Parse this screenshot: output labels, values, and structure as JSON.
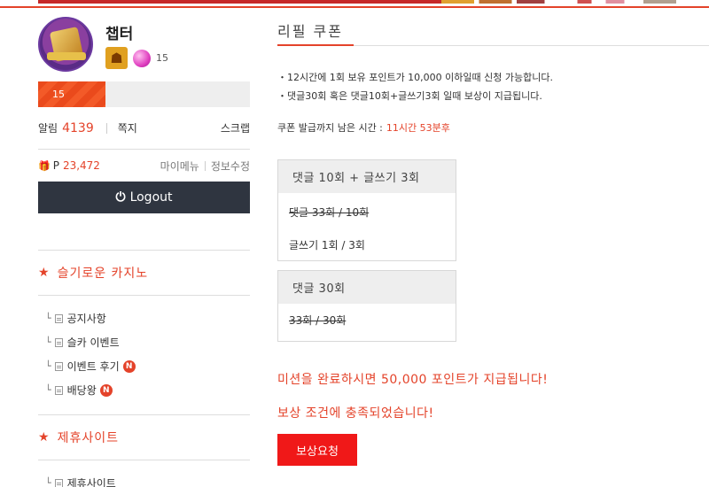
{
  "sidebar": {
    "nickname": "챕터",
    "level": "15",
    "xp_level": "15",
    "xp_progress": 0.32,
    "alarm_label": "알림",
    "alarm_count": "4139",
    "memo_label": "쪽지",
    "scrap_label": "스크랩",
    "point_prefix": "P",
    "point_value": "23,472",
    "mymenu_label": "마이메뉴",
    "edit_info_label": "정보수정",
    "logout_label": "Logout",
    "section1_title": "슬기로운 카지노",
    "section1_items": [
      {
        "label": "공지사항",
        "new": false
      },
      {
        "label": "슬카 이벤트",
        "new": false
      },
      {
        "label": "이벤트 후기",
        "new": true
      },
      {
        "label": "배당왕",
        "new": true
      }
    ],
    "new_badge": "N",
    "section2_title": "제휴사이트",
    "section2_items": [
      {
        "label": "제휴사이트"
      }
    ]
  },
  "main": {
    "page_title": "리필 쿠폰",
    "rules": [
      "・12시간에 1회 보유 포인트가 10,000 이하일때 신청 가능합니다.",
      "・댓글30회 혹은 댓글10회+글쓰기3회 일때 보상이 지급됩니다."
    ],
    "timer_label": "쿠폰 발급까지 남은 시간 :",
    "timer_value": "11시간 53분후",
    "mission1": {
      "title": "댓글 10회 + 글쓰기 3회",
      "row1": "댓글 33회 / 10회",
      "row2": "글쓰기 1회 / 3회"
    },
    "mission2": {
      "title": "댓글 30회",
      "row1": "33회 / 30회"
    },
    "complete_msg": "미션을 완료하시면 50,000 포인트가 지급됩니다!",
    "met_msg": "보상 조건에 충족되었습니다!",
    "reward_button": "보상요청"
  },
  "colors": {
    "accent": "#e4432a",
    "button_red": "#f01818",
    "logout_bg": "#2f3540"
  }
}
